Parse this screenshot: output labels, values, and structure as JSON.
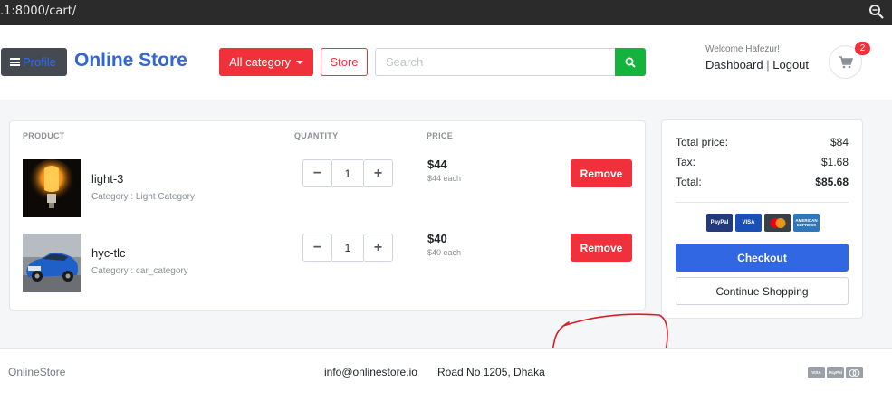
{
  "browser": {
    "url": ".1:8000/cart/",
    "zoom_icon": "magnifier-icon"
  },
  "header": {
    "profile_label": "Profile",
    "brand": "Online Store",
    "category_label": "All category",
    "store_label": "Store",
    "search_placeholder": "Search",
    "search_value": "",
    "welcome": "Welcome Hafezur!",
    "dashboard_label": "Dashboard",
    "separator": "|",
    "logout_label": "Logout",
    "cart_count": "2"
  },
  "cart": {
    "columns": {
      "product": "PRODUCT",
      "quantity": "QUANTITY",
      "price": "PRICE"
    },
    "items": [
      {
        "name": "light-3",
        "category": "Category : Light Category",
        "quantity": "1",
        "price": "$44",
        "each": "$44 each",
        "remove_label": "Remove",
        "minus": "−",
        "plus": "+"
      },
      {
        "name": "hyc-tlc",
        "category": "Category : car_category",
        "quantity": "1",
        "price": "$40",
        "each": "$40 each",
        "remove_label": "Remove",
        "minus": "−",
        "plus": "+"
      }
    ]
  },
  "summary": {
    "total_price_label": "Total price:",
    "total_price_value": "$84",
    "tax_label": "Tax:",
    "tax_value": "$1.68",
    "total_label": "Total:",
    "total_value": "$85.68",
    "payment_methods": [
      "PayPal",
      "VISA",
      "mastercard",
      "AMERICAN EXPRESS"
    ],
    "checkout_label": "Checkout",
    "continue_label": "Continue Shopping"
  },
  "footer": {
    "brand": "OnlineStore",
    "email": "info@onlinestore.io",
    "address": "Road No 1205, Dhaka",
    "payment_methods": [
      "VISA",
      "PayPal",
      "mastercard"
    ]
  },
  "colors": {
    "brand_blue": "#3167d3",
    "danger_red": "#f0303a",
    "success_green": "#14b43c",
    "primary_blue": "#3167e3",
    "annotation_red": "#d81e2a"
  }
}
